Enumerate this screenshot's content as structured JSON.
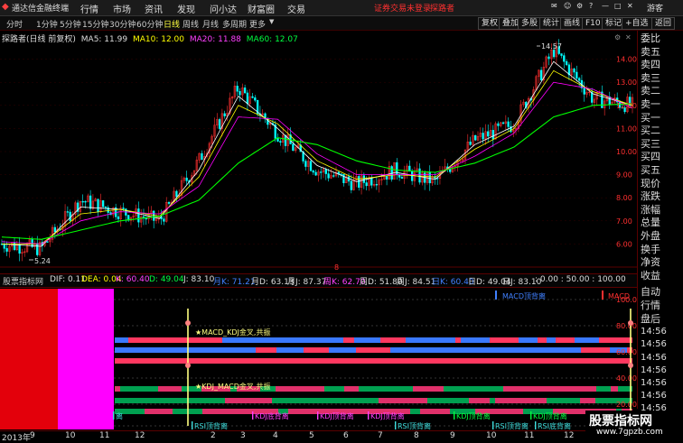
{
  "menubar": {
    "app_title": "通达信金融终端",
    "items": [
      "行情",
      "市场",
      "资讯",
      "发现",
      "问小达",
      "财富圈",
      "交易"
    ],
    "status_warning": "证券交易未登录",
    "status_user": "探路者",
    "guest_label": "游客"
  },
  "period_tabs": [
    "分时",
    "1分钟",
    "5分钟",
    "15分钟",
    "30分钟",
    "60分钟",
    "日线",
    "周线",
    "月线",
    "多周期",
    "更多"
  ],
  "toolbar_right": [
    "复权",
    "叠加",
    "多股",
    "统计",
    "画线",
    "F10",
    "标记",
    "+自选",
    "返回"
  ],
  "chart_header": {
    "stock": "探路者(日线 前复权)",
    "ma5_label": "MA5: 11.99",
    "ma10_label": "MA10: 12.00",
    "ma20_label": "MA20: 11.88",
    "ma60_label": "MA60: 12.07"
  },
  "annotations": {
    "high": "14.57",
    "low": "5.24",
    "marker": "8"
  },
  "price_axis": [
    "14.00",
    "13.00",
    "12.00",
    "11.00",
    "10.00",
    "9.00",
    "8.00",
    "7.00",
    "6.00"
  ],
  "indicator_line": {
    "title": "股票指标网",
    "dif": "DIF: 0.11",
    "dea": "DEA: 0.04",
    "k": "K: 60.40",
    "d": "D: 49.04",
    "j": "J: 83.10",
    "yk": "月K: 71.21",
    "yd": "月D: 63.13",
    "yj": "月J: 87.37",
    "zk": "周K: 62.70",
    "zd": "周D: 51.80",
    "zj": "周J: 84.51",
    "rk": "日K: 60.40",
    "rd": "日D: 49.04",
    "rj": "日J: 83.10",
    "tail": ": 0.00  : 50.00  : 100.00"
  },
  "signal_labels": {
    "macd_top": "MACD顶背离",
    "macd_short": "MACD",
    "resonance1": "★MACD_KDJ金叉,共振",
    "resonance2": "★KDJ_MACD金叉,共振",
    "kdj_top": "KDJ顶背离",
    "kdj_bottom": "KDJ底背离",
    "rsi_top": "RSI顶背离",
    "rsi_bottom": "RSI底背离",
    "div_fragment": "离"
  },
  "lower_axis": [
    "100.00",
    "80.00",
    "60.00",
    "40.00",
    "20.00",
    "0.00"
  ],
  "right_panel": {
    "depth": [
      "委比",
      "卖五",
      "卖四",
      "卖三",
      "卖二",
      "卖一",
      "买一",
      "买二",
      "买三",
      "买四",
      "买五"
    ],
    "stats": [
      "现价",
      "涨跌",
      "涨幅",
      "总量",
      "外盘",
      "换手",
      "净资",
      "收益"
    ],
    "bottom": [
      "自动",
      "行情",
      "盘后"
    ],
    "times": [
      "14:56",
      "14:56",
      "14:56",
      "14:56",
      "14:56",
      "14:56",
      "14:56",
      "14:56"
    ]
  },
  "time_axis": [
    "2013年",
    "9",
    "10",
    "11",
    "12",
    "2",
    "3",
    "4",
    "5",
    "6",
    "7",
    "8",
    "9",
    "10",
    "11",
    "12"
  ],
  "watermark": {
    "cn": "股票指标网",
    "url": "www.7gpzb.com"
  },
  "colors": {
    "up": "#ff3030",
    "down": "#00ffff",
    "ma5": "#ffffff",
    "ma10": "#ffff00",
    "ma20": "#ff00ff",
    "ma60": "#00ff00",
    "bg": "#000000",
    "grid": "#5a0000"
  },
  "chart_data": {
    "type": "candlestick",
    "title": "探路者(日线 前复权)",
    "ylim": [
      5.0,
      15.0
    ],
    "x": [
      "2013-08",
      "2013-09",
      "2013-10",
      "2013-11",
      "2013-12",
      "2014-01",
      "2014-02",
      "2014-03",
      "2014-04",
      "2014-05",
      "2014-06",
      "2014-07",
      "2014-08",
      "2014-09",
      "2014-10",
      "2014-11",
      "2014-12"
    ],
    "close": [
      6.0,
      5.8,
      7.9,
      7.4,
      7.0,
      9.6,
      12.8,
      10.8,
      9.2,
      8.6,
      9.2,
      8.7,
      10.5,
      11.2,
      14.4,
      12.3,
      12.0
    ],
    "low_point": 5.24,
    "high_point": 14.57,
    "series": [
      {
        "name": "MA5: 11.99",
        "values": [
          6.0,
          5.9,
          7.6,
          7.5,
          7.1,
          9.2,
          12.4,
          11.0,
          9.4,
          8.7,
          9.1,
          8.8,
          10.3,
          11.1,
          13.9,
          12.5,
          11.99
        ]
      },
      {
        "name": "MA10: 12.00",
        "values": [
          6.0,
          6.0,
          7.3,
          7.5,
          7.2,
          8.9,
          12.0,
          11.2,
          9.6,
          8.8,
          9.0,
          8.9,
          10.1,
          11.0,
          13.5,
          12.6,
          12.0
        ]
      },
      {
        "name": "MA20: 11.88",
        "values": [
          6.1,
          6.0,
          7.0,
          7.4,
          7.3,
          8.5,
          11.5,
          11.4,
          9.9,
          9.0,
          9.0,
          9.0,
          9.8,
          10.8,
          13.0,
          12.7,
          11.88
        ]
      },
      {
        "name": "MA60: 12.07",
        "values": [
          6.3,
          6.2,
          6.6,
          7.0,
          7.2,
          7.9,
          9.5,
          10.6,
          10.3,
          9.6,
          9.2,
          9.1,
          9.5,
          10.2,
          11.5,
          12.0,
          12.07
        ]
      }
    ]
  }
}
